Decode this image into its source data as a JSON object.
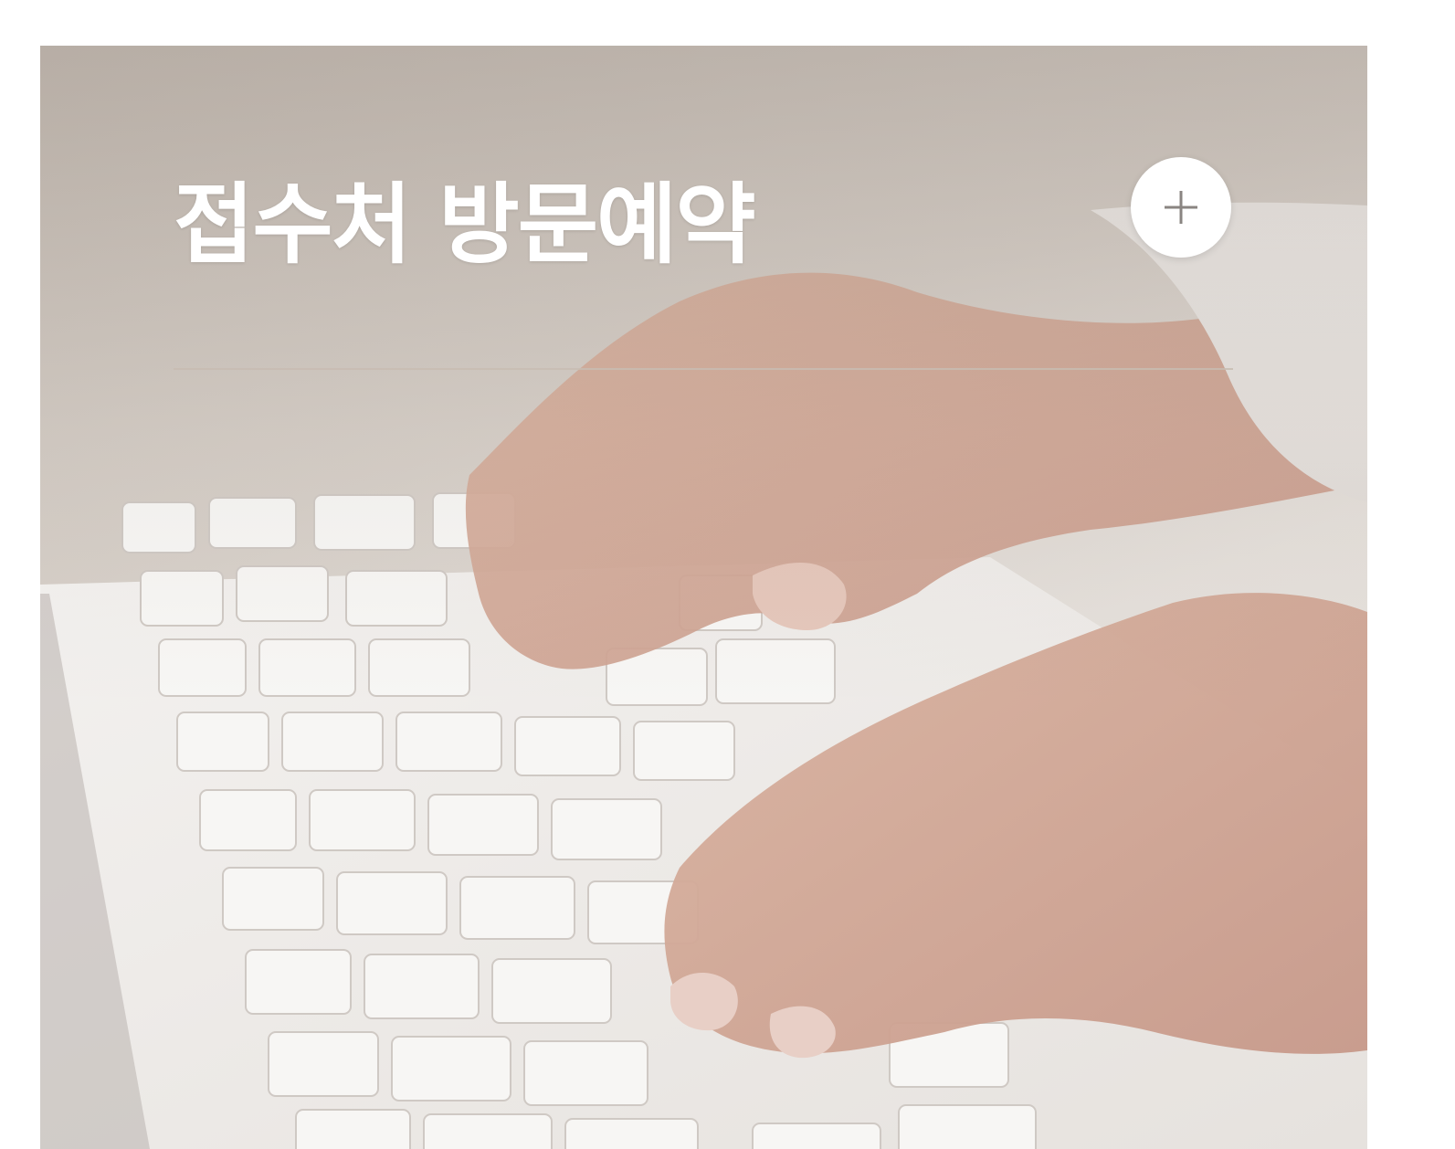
{
  "card": {
    "title": "접수처 방문예약",
    "plus_icon": "plus-icon",
    "background_image": "hands-typing-on-white-keyboard",
    "colors": {
      "title": "#ffffff",
      "button_bg": "#ffffff",
      "plus_stroke": "#8a8582"
    }
  }
}
